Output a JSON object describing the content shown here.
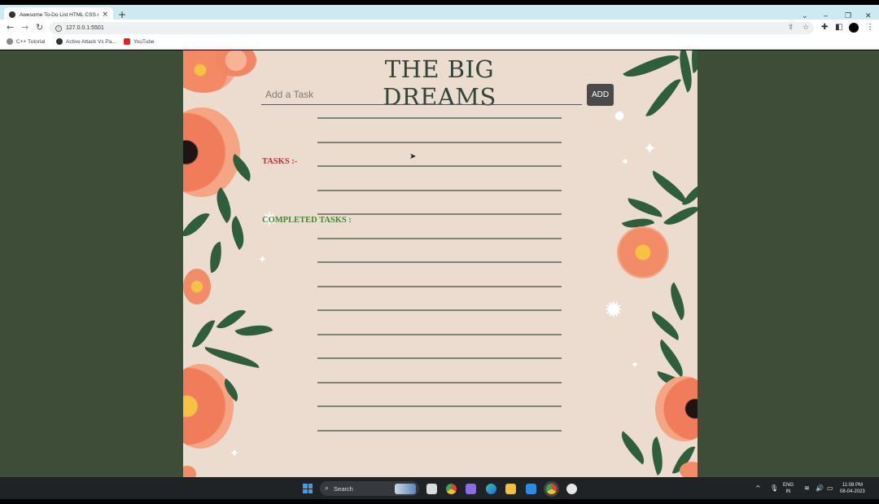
{
  "browser": {
    "tab_title": "Awesome To-Do List HTML CSS /",
    "tab_close": "×",
    "new_tab": "+",
    "url": "127.0.0.1:5501",
    "bookmarks": [
      {
        "label": "C++ Tutorial",
        "icon": "globe-icon"
      },
      {
        "label": "Active Attack Vs Pa...",
        "icon": "globe-icon"
      },
      {
        "label": "YouTube",
        "icon": "youtube-icon"
      }
    ]
  },
  "app": {
    "heading": "THE BIG DREAMS",
    "input_placeholder": "Add a Task",
    "add_button": "ADD",
    "tasks_label": "TASKS :-",
    "completed_label": "COMPLETED TASKS :"
  },
  "taskbar": {
    "search_label": "Search",
    "language_line1": "ENG",
    "language_line2": "IN",
    "time": "11:08 PM",
    "date": "08-04-2023"
  },
  "colors": {
    "page_background": "#3d4d38",
    "card_background": "#ecdccf",
    "heading": "#33453a",
    "tasks_label": "#c03030",
    "completed_label": "#3c8a2e",
    "add_button": "#4a4a4a"
  }
}
